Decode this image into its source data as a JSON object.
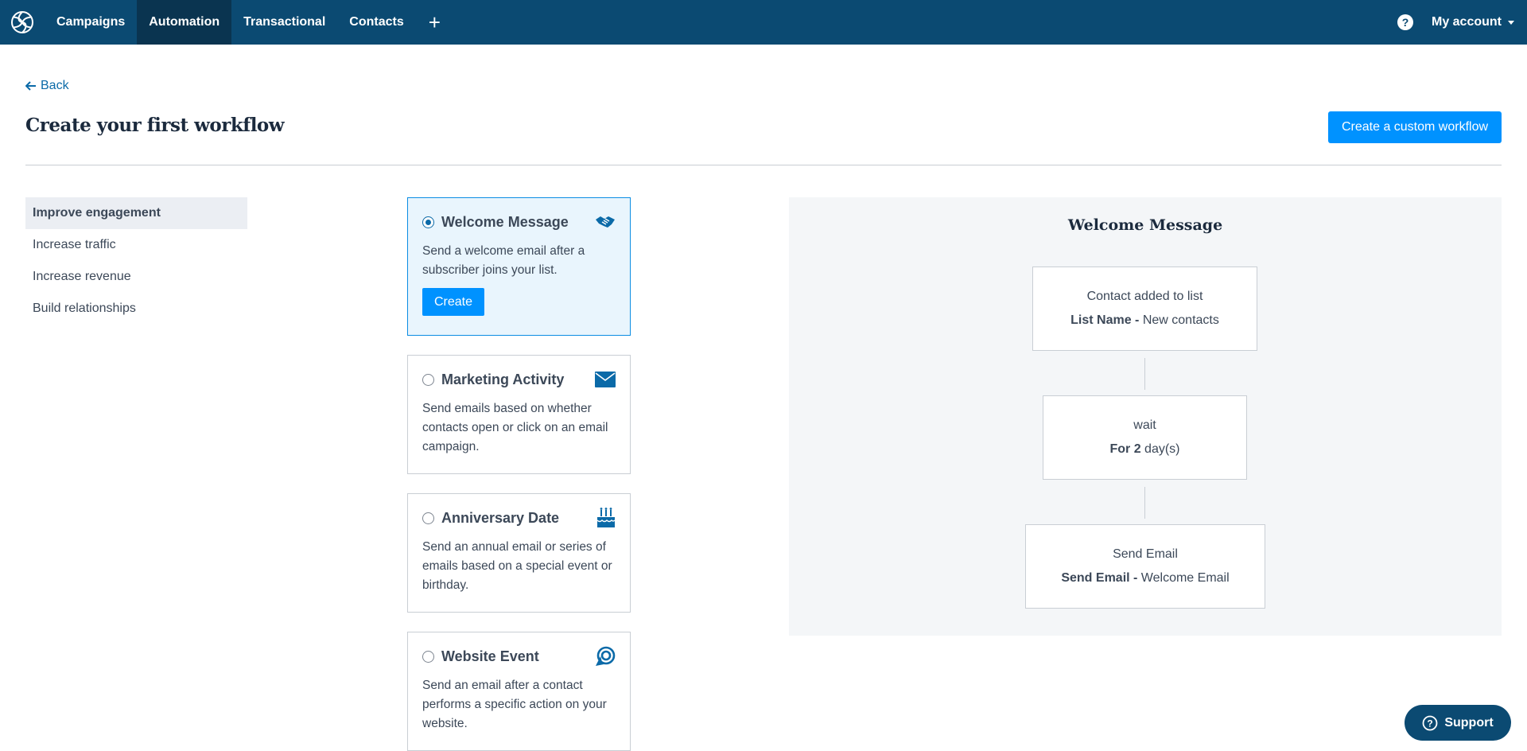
{
  "nav": {
    "logo_icon": "sendinblue-logo-icon",
    "items": [
      {
        "label": "Campaigns",
        "active": false
      },
      {
        "label": "Automation",
        "active": true
      },
      {
        "label": "Transactional",
        "active": false
      },
      {
        "label": "Contacts",
        "active": false
      }
    ],
    "plus_icon": "+",
    "help_icon": "help-circle-icon",
    "account_label": "My account"
  },
  "header": {
    "back_label": "Back",
    "title": "Create your first workflow",
    "custom_button_label": "Create a custom workflow"
  },
  "sidebar": {
    "items": [
      {
        "label": "Improve engagement",
        "active": true
      },
      {
        "label": "Increase traffic",
        "active": false
      },
      {
        "label": "Increase revenue",
        "active": false
      },
      {
        "label": "Build relationships",
        "active": false
      }
    ]
  },
  "cards": [
    {
      "title": "Welcome Message",
      "description": "Send a welcome email after a subscriber joins your list.",
      "icon": "handshake-icon",
      "selected": true,
      "button_label": "Create"
    },
    {
      "title": "Marketing Activity",
      "description": "Send emails based on whether contacts open or click on an email campaign.",
      "icon": "envelope-icon",
      "selected": false
    },
    {
      "title": "Anniversary Date",
      "description": "Send an annual email or series of emails based on a special event or birthday.",
      "icon": "birthday-cake-icon",
      "selected": false
    },
    {
      "title": "Website Event",
      "description": "Send an email after a contact performs a specific action on your website.",
      "icon": "target-cursor-icon",
      "selected": false
    }
  ],
  "preview": {
    "title": "Welcome Message",
    "steps": [
      {
        "label": "Contact added to list",
        "detail_bold": "List Name -",
        "detail": " New contacts"
      },
      {
        "label": "wait",
        "detail_bold": "For 2",
        "detail": " day(s)"
      },
      {
        "label": "Send Email",
        "detail_bold": "Send Email -",
        "detail": " Welcome Email"
      }
    ]
  },
  "support": {
    "label": "Support",
    "icon": "help-circle-icon"
  },
  "colors": {
    "nav_bg": "#0b4a72",
    "nav_active_bg": "#0a3450",
    "primary_button": "#0092ff",
    "selected_card_bg": "#e9f5fd",
    "selected_card_border": "#0b8de3",
    "preview_bg": "#f4f6f8"
  }
}
